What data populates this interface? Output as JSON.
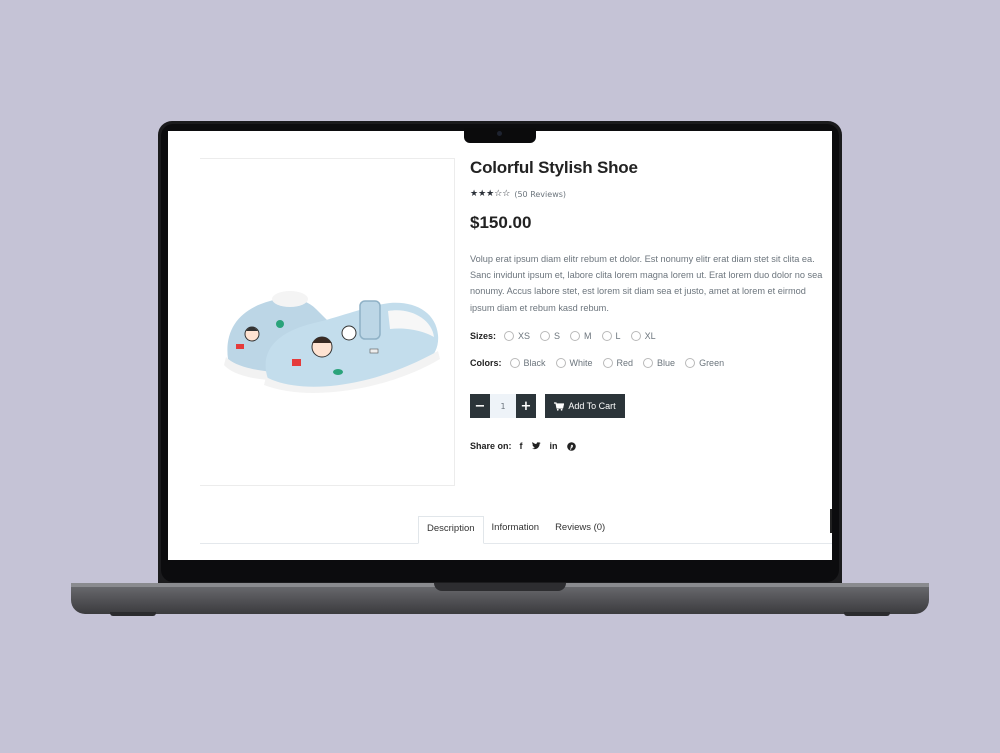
{
  "product": {
    "title": "Colorful Stylish Shoe",
    "stars": "★★★☆☆",
    "rating_value": 3.5,
    "reviews_label": "(50 Reviews)",
    "price": "$150.00",
    "description": "Volup erat ipsum diam elitr rebum et dolor. Est nonumy elitr erat diam stet sit clita ea. Sanc invidunt ipsum et, labore clita lorem magna lorem ut. Erat lorem duo dolor no sea nonumy. Accus labore stet, est lorem sit diam sea et justo, amet at lorem et eirmod ipsum diam et rebum kasd rebum."
  },
  "sizes": {
    "label": "Sizes:",
    "options": [
      "XS",
      "S",
      "M",
      "L",
      "XL"
    ]
  },
  "colors": {
    "label": "Colors:",
    "options": [
      "Black",
      "White",
      "Red",
      "Blue",
      "Green"
    ]
  },
  "quantity": {
    "minus": "−",
    "value": "1",
    "plus": "+"
  },
  "cart": {
    "label": "Add To Cart",
    "icon": "cart-icon"
  },
  "share": {
    "label": "Share on:",
    "icons": [
      "facebook-icon",
      "twitter-icon",
      "linkedin-icon",
      "pinterest-icon"
    ],
    "facebook": "f",
    "linkedin": "in"
  },
  "tabs": [
    "Description",
    "Information",
    "Reviews (0)"
  ],
  "colors_theme": {
    "background": "#c5c3d6",
    "button": "#2b3439",
    "text": "#222222",
    "muted": "#6c757d"
  }
}
